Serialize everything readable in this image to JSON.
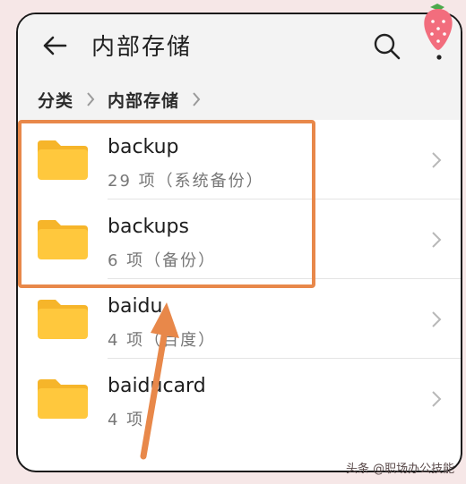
{
  "appbar": {
    "title": "内部存储",
    "back_icon": "arrow-left-icon",
    "search_icon": "search-icon",
    "more_icon": "more-vertical-icon"
  },
  "breadcrumb": {
    "items": [
      "分类",
      "内部存储"
    ]
  },
  "files": [
    {
      "name": "backup",
      "meta": "29 项（系统备份）"
    },
    {
      "name": "backups",
      "meta": "6 项（备份）"
    },
    {
      "name": "baidu",
      "meta": "4 项（百度）"
    },
    {
      "name": "baiducard",
      "meta": "4 项"
    }
  ],
  "annotation": {
    "highlight_color": "#e8884a"
  },
  "watermark": "头条 @职场办公技能",
  "colors": {
    "folder": "#ffc83d",
    "folder_tab": "#f6b52a",
    "appbar_bg": "#f3f3f3"
  }
}
